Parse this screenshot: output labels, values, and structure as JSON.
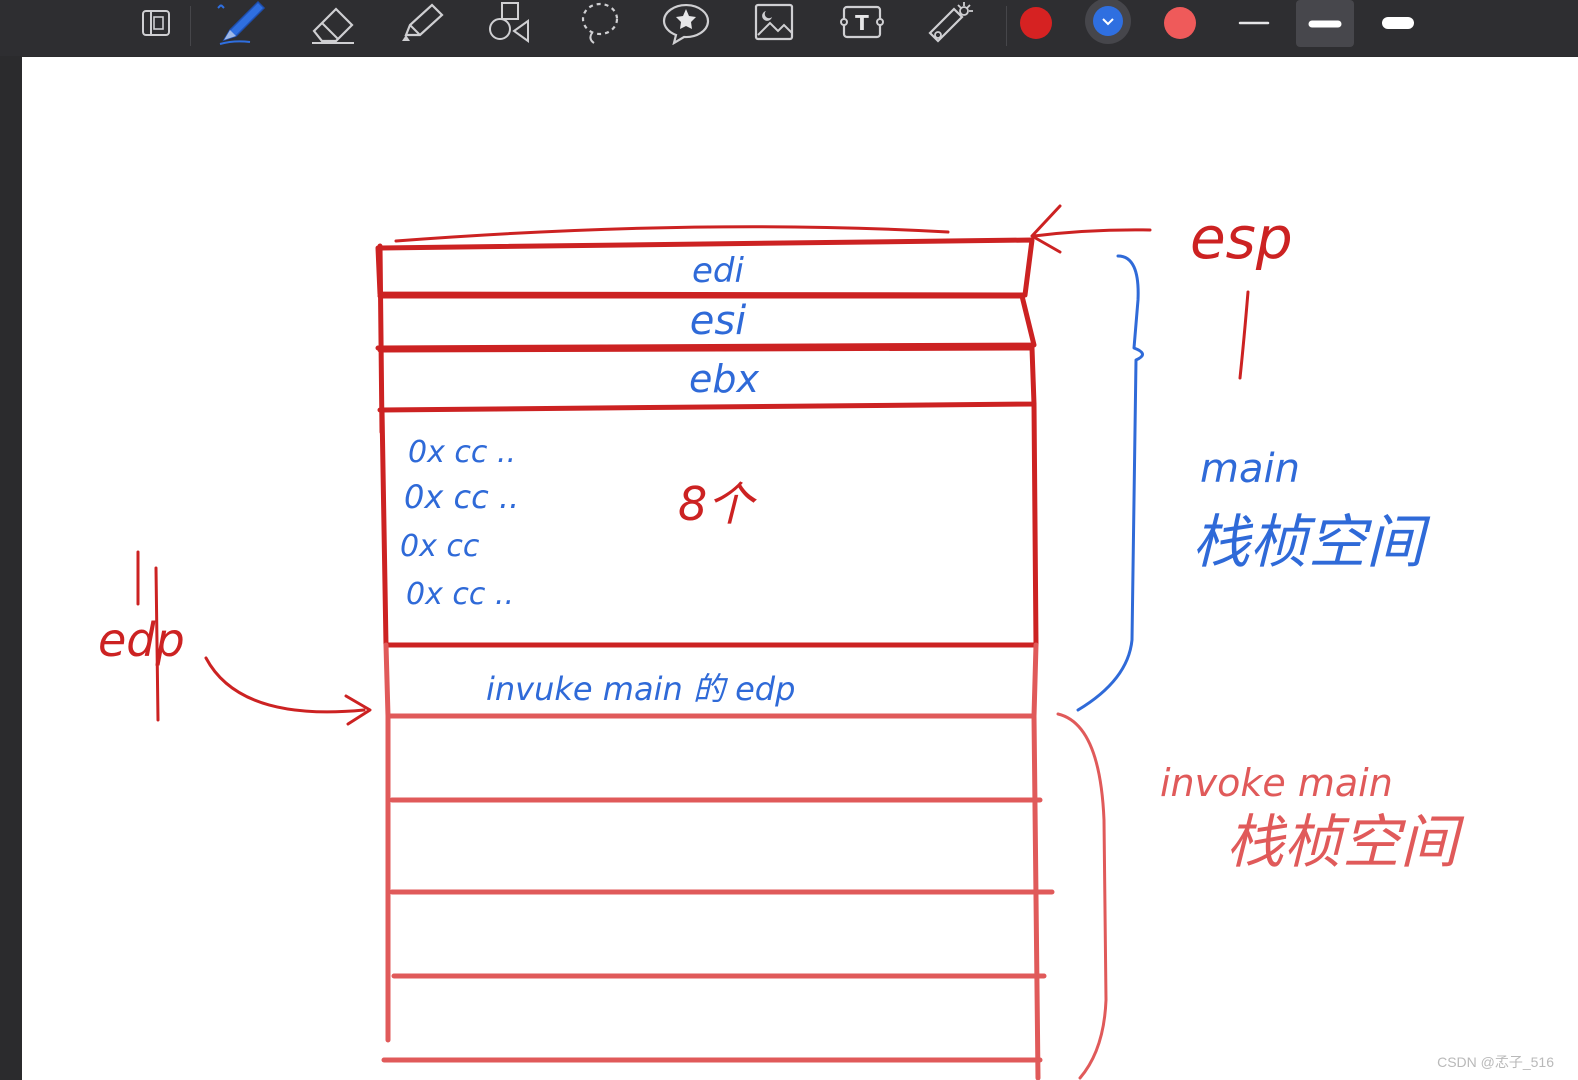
{
  "toolbar": {
    "tools": [
      {
        "id": "page-layout",
        "icon": "page-layout-icon"
      },
      {
        "id": "pen",
        "icon": "pen-icon",
        "active": true
      },
      {
        "id": "eraser",
        "icon": "eraser-icon"
      },
      {
        "id": "highlighter",
        "icon": "highlighter-icon"
      },
      {
        "id": "shapes",
        "icon": "shapes-icon"
      },
      {
        "id": "lasso",
        "icon": "lasso-icon"
      },
      {
        "id": "sticker",
        "icon": "sticker-icon"
      },
      {
        "id": "image",
        "icon": "image-icon"
      },
      {
        "id": "text",
        "icon": "text-box-icon",
        "glyph": "T"
      },
      {
        "id": "laser",
        "icon": "laser-pointer-icon"
      }
    ],
    "colors": [
      "#d62222",
      "#2f6fe0",
      "#ef5a5a"
    ],
    "selected_color": "#2f6fe0",
    "stroke_widths": [
      "thin",
      "medium",
      "thick"
    ],
    "selected_stroke": "medium"
  },
  "drawing": {
    "colors": {
      "red": "#cc2222",
      "pink": "#e05a5a",
      "blue": "#2f6ad8"
    },
    "stack_labels": {
      "edi": "edi",
      "esi": "esi",
      "ebx": "ebx",
      "saved_ebp": "invuke main 的 edp"
    },
    "fill_rows": [
      "0x cc ..",
      "0x cc ..",
      "0x cc",
      "0x cc .."
    ],
    "count_label": "8个",
    "pointer_esp": "esp",
    "pointer_ebp": "edp",
    "frame_main": {
      "line1": "main",
      "line2": "栈桢空间"
    },
    "frame_invoke": {
      "line1": "invoke main",
      "line2": "栈桢空间"
    }
  },
  "watermark": "CSDN @孞子_516"
}
